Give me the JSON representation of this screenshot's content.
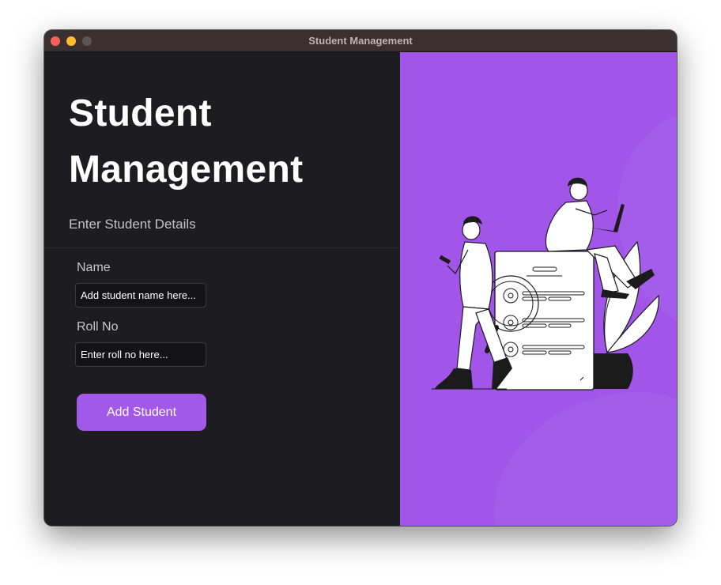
{
  "window": {
    "title": "Student Management"
  },
  "left_panel": {
    "heading_line1": "Student",
    "heading_line2": "Management",
    "subtitle": "Enter Student Details"
  },
  "form": {
    "name_label": "Name",
    "name_placeholder": "Add student name here...",
    "roll_label": "Roll No",
    "roll_placeholder": "Enter roll no here...",
    "submit_label": "Add Student"
  },
  "colors": {
    "accent": "#a259ea",
    "panel_bg": "#1d1d21",
    "illustration_bg": "#a155e9",
    "titlebar": "#3a302f"
  }
}
